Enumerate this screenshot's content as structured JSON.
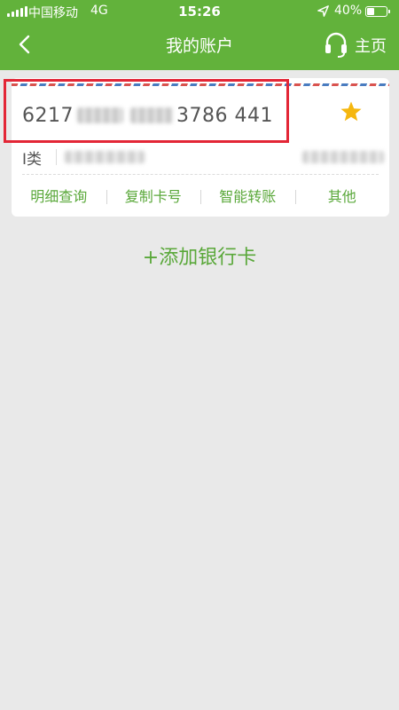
{
  "status_bar": {
    "carrier": "中国移动",
    "network": "4G",
    "time": "15:26",
    "battery_percent": "40%",
    "battery_level": 0.4
  },
  "nav": {
    "title": "我的账户",
    "home_label": "主页",
    "back_icon": "chevron-left-icon",
    "support_icon": "headset-icon"
  },
  "card": {
    "number_prefix": "6217",
    "number_suffix": "3786 441",
    "type_label": "I类",
    "favorite_icon": "star-icon",
    "actions": [
      "明细查询",
      "复制卡号",
      "智能转账",
      "其他"
    ]
  },
  "add_card_label": "+添加银行卡",
  "colors": {
    "header_green": "#62b23b",
    "accent_green": "#5aa83a",
    "star_gold": "#f5b70f",
    "highlight_red": "#e32636",
    "background": "#e9e9e9"
  }
}
